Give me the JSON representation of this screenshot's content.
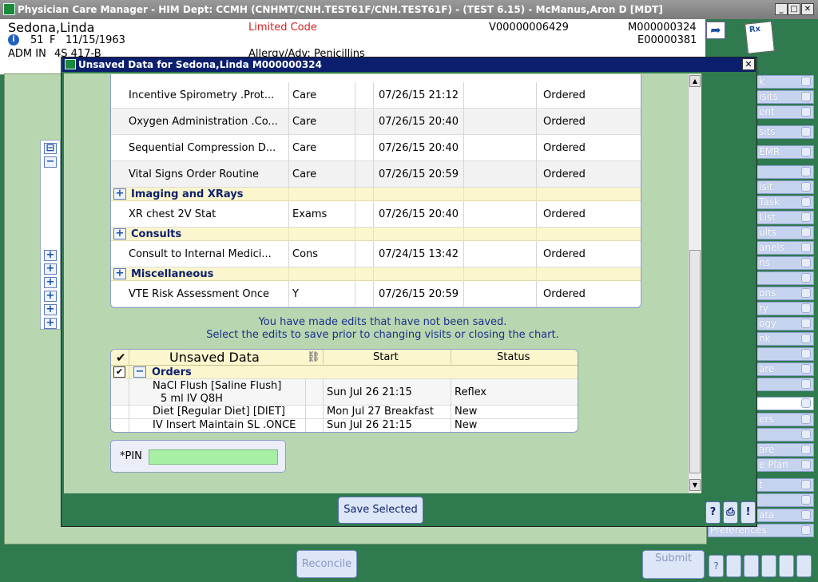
{
  "window": {
    "title": "Physician Care Manager - HIM Dept: CCMH (CNHMT/CNH.TEST61F/CNH.TEST61F) - (TEST 6.15) - McManus,Aron D [MDT]",
    "minimize": "_",
    "maximize": "□",
    "close": "✕"
  },
  "patient": {
    "name": "Sedona,Linda",
    "age": "51",
    "sex": "F",
    "dob": "11/15/1963",
    "status": "ADM IN",
    "location": "4S   417-B",
    "code": "Limited Code",
    "allergy": "Allergy/Adv: Penicillins",
    "visit": "V00000006429",
    "mrn": "M000000324",
    "encounter": "E00000381",
    "rx_label": "Rx"
  },
  "sidebar": {
    "items": [
      "k",
      "isits",
      "ent",
      "sits",
      "EMR",
      "",
      "isit",
      "Task",
      "List",
      "ults",
      "anels",
      "ns",
      "",
      "ons",
      "ry",
      "ogy",
      "nk",
      "",
      "are",
      "",
      "",
      "ers",
      "",
      "are",
      "e Plan",
      "t",
      "",
      "ata",
      "Preferences"
    ]
  },
  "dialog": {
    "title": "Unsaved Data for Sedona,Linda M000000324",
    "close": "✕",
    "orders": [
      {
        "type": "row",
        "name": "Incentive Spirometry .Prot...",
        "cat": "Care",
        "datetime": "07/26/15 21:12",
        "status": "Ordered"
      },
      {
        "type": "row",
        "name": "Oxygen Administration .Co...",
        "cat": "Care",
        "datetime": "07/26/15 20:40",
        "status": "Ordered"
      },
      {
        "type": "row",
        "name": "Sequential Compression D...",
        "cat": "Care",
        "datetime": "07/26/15 20:40",
        "status": "Ordered"
      },
      {
        "type": "row",
        "name": "Vital Signs Order Routine",
        "cat": "Care",
        "datetime": "07/26/15 20:59",
        "status": "Ordered"
      },
      {
        "type": "group",
        "name": "Imaging and XRays"
      },
      {
        "type": "row",
        "name": "XR chest 2V Stat",
        "cat": "Exams",
        "datetime": "07/26/15 20:40",
        "status": "Ordered"
      },
      {
        "type": "group",
        "name": "Consults"
      },
      {
        "type": "row",
        "name": "Consult to Internal Medici...",
        "cat": "Cons",
        "datetime": "07/24/15 13:42",
        "status": "Ordered"
      },
      {
        "type": "group",
        "name": "Miscellaneous"
      },
      {
        "type": "row",
        "name": "VTE Risk Assessment Once",
        "cat": "Y",
        "datetime": "07/26/15 20:59",
        "status": "Ordered"
      }
    ],
    "warning_line1": "You have made edits that have not been saved.",
    "warning_line2": "Select the edits to save prior to changing visits or closing the chart.",
    "unsaved": {
      "header_check": "✔",
      "title": "Unsaved Data",
      "col_start": "Start",
      "col_status": "Status",
      "group_label": "Orders",
      "rows": [
        {
          "line1": "NaCl Flush [Saline Flush]",
          "line2": "5 ml IV Q8H",
          "start": "Sun  Jul   26 21:15",
          "status": "Reflex"
        },
        {
          "line1": "Diet [Regular Diet] [DIET]",
          "line2": "",
          "start": "Mon  Jul   27 Breakfast",
          "status": "New"
        },
        {
          "line1": "IV Insert Maintain SL .ONCE",
          "line2": "",
          "start": "Sun  Jul   26 21:15",
          "status": "New"
        }
      ]
    },
    "pin_label": "*PIN",
    "pin_value": "",
    "save_button": "Save Selected",
    "help_label": "?",
    "more_label": "!"
  },
  "bottom": {
    "reconcile": "Reconcile",
    "submit": "Submit",
    "help": "?"
  }
}
